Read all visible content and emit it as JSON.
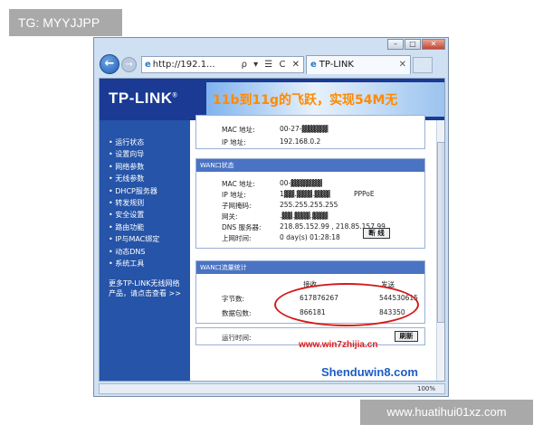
{
  "watermarks": {
    "top_left": "TG: MYYJJPP",
    "bottom_right": "www.huatihui01xz.com"
  },
  "browser": {
    "address": "http://192.1...",
    "address_controls": "ρ ▾ ☰ C ✕",
    "tab_title": "TP-LINK",
    "tab_close": "✕",
    "window_buttons": [
      "–",
      "□",
      "✕"
    ],
    "back_glyph": "←",
    "forward_glyph": "→",
    "ie_icon": "e"
  },
  "banner": {
    "logo": "TP-LINK",
    "logo_mark": "®",
    "slogan": "11b到11g的飞跃，实现54M无"
  },
  "sidebar": {
    "items": [
      "运行状态",
      "设置向导",
      "网络参数",
      "无线参数",
      "DHCP服务器",
      "转发规则",
      "安全设置",
      "路由功能",
      "IP与MAC绑定",
      "动态DNS",
      "系统工具"
    ],
    "more_line1": "更多TP-LINK无线网络",
    "more_line2": "产品，请点击查看 >>"
  },
  "lan": {
    "mac_label": "MAC 地址:",
    "mac_value": "00-27-▓▓▓▓▓",
    "ip_label": "IP 地址:",
    "ip_value": "192.168.0.2"
  },
  "wan": {
    "title": "WAN口状态",
    "mac_label": "MAC 地址:",
    "mac_value": "00-▓▓▓▓▓▓",
    "ip_label": "IP 地址:",
    "ip_value": "1▓▓.▓▓▓.▓▓▓",
    "ip_type": "PPPoE",
    "mask_label": "子网掩码:",
    "mask_value": "255.255.255.255",
    "gateway_label": "网关:",
    "gateway_value": ".▓▓.▓▓▓.▓▓▓",
    "dns_label": "DNS 服务器:",
    "dns_value": "218.85.152.99 , 218.85.157.99",
    "uptime_label": "上网时间:",
    "uptime_value": "0 day(s) 01:28:18",
    "disconnect_button": "断 线"
  },
  "traffic": {
    "title": "WAN口流量统计",
    "col_received": "接收",
    "col_sent": "发送",
    "bytes_label": "字节数:",
    "bytes_received": "617876267",
    "bytes_sent": "544530615",
    "packets_label": "数据包数:",
    "packets_received": "866181",
    "packets_sent": "843350"
  },
  "runtime": {
    "label": "运行时间:",
    "refresh_button": "刷新"
  },
  "status_bar": {
    "zoom": "100%"
  },
  "overlay_watermarks": {
    "site": "www.win7zhijia.cn",
    "site2": "Shenduwin8.com"
  },
  "colors": {
    "banner": "#1a3a93",
    "sidebar": "#2554a8",
    "panel_header": "#4a73c3",
    "highlight_ellipse": "#d41a1a"
  }
}
